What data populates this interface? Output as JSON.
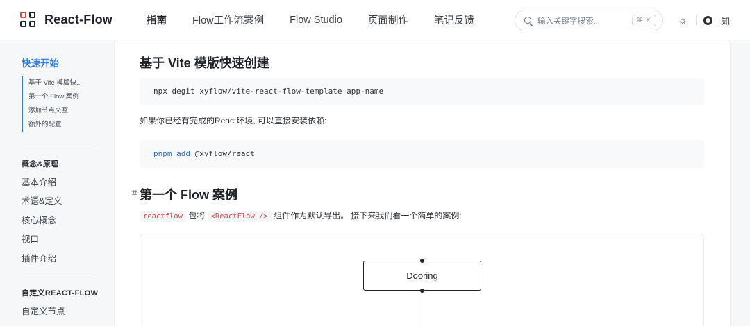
{
  "header": {
    "brand": "React-Flow",
    "nav": [
      {
        "label": "指南",
        "active": true
      },
      {
        "label": "Flow工作流案例",
        "active": false
      },
      {
        "label": "Flow Studio",
        "active": false
      },
      {
        "label": "页面制作",
        "active": false
      },
      {
        "label": "笔记反馈",
        "active": false
      }
    ],
    "search": {
      "placeholder": "输入关键字搜索...",
      "shortcut": "⌘ K"
    },
    "icons": [
      "sun-icon",
      "github-icon"
    ],
    "zhi_label": "知"
  },
  "sidebar": {
    "start_label": "快速开始",
    "toc": [
      "基于 Vite 模版快...",
      "第一个 Flow 案例",
      "添加节点交互",
      "额外的配置"
    ],
    "section1": {
      "title": "概念&原理",
      "items": [
        "基本介绍",
        "术语&定义",
        "核心概念",
        "视口",
        "插件介绍"
      ]
    },
    "section2": {
      "title": "自定义REACT-FLOW",
      "items": [
        "自定义节点"
      ]
    }
  },
  "main": {
    "h_vite": "基于 Vite 模版快速创建",
    "code1": "npx degit xyflow/vite-react-flow-template app-name",
    "para1": "如果你已经有完成的React环境, 可以直接安装依赖:",
    "code2": {
      "kw1": "pnpm",
      "kw2": "add",
      "rest": " @xyflow/react"
    },
    "hash": "#",
    "h_flow": "第一个 Flow 案例",
    "para2": {
      "code_a": "reactflow",
      "text_a": " 包将 ",
      "code_b": "<ReactFlow />",
      "text_b": " 组件作为默认导出。 接下来我们看一个简单的案例:"
    },
    "node_label": "Dooring"
  },
  "colors": {
    "accent": "#2f7fd7",
    "inline_code": "#d24b4b",
    "keyword": "#2c6cbd"
  }
}
